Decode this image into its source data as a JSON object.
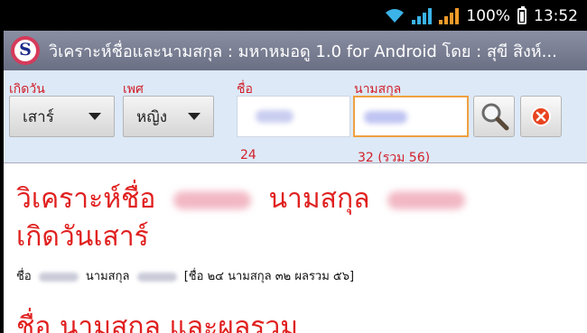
{
  "status_bar": {
    "battery": "100%",
    "time": "13:52"
  },
  "app": {
    "title": "วิเคราะห์ชื่อและนามสกุล : มหาหมอดู 1.0 for Android โดย : สุขี สิงห์..."
  },
  "form": {
    "birthday_label": "เกิดวัน",
    "birthday_value": "เสาร์",
    "gender_label": "เพศ",
    "gender_value": "หญิง",
    "firstname_label": "ชื่อ",
    "lastname_label": "นามสกุล",
    "firstname_score": "24",
    "lastname_score": "32  (รวม 56)"
  },
  "result": {
    "heading_analyze": "วิเคราะห์ชื่อ",
    "heading_surname": "นามสกุล",
    "heading_day": "เกิดวันเสาร์",
    "line_name_label": "ชื่อ",
    "line_surname_label": "นามสกุล",
    "line_summary": "[ชื่อ ๒๔  นามสกุล ๓๒  ผลรวม ๕๖]",
    "cut_heading": "ชื่อ นามสกุล และผลรวม"
  },
  "colors": {
    "accent_red": "#e0201f",
    "panel_bg": "#dde9f7",
    "focus_orange": "#f0a040"
  }
}
